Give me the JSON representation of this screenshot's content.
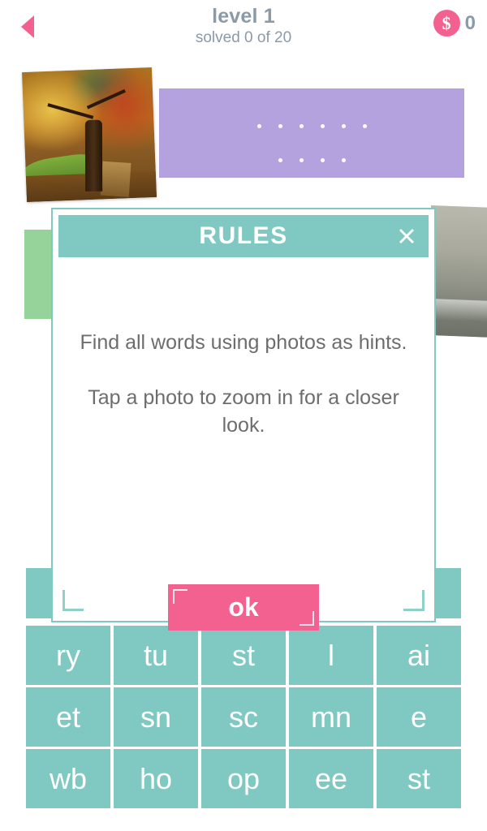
{
  "header": {
    "back_icon": "back-triangle-icon",
    "level_title": "level 1",
    "solved_text": "solved 0 of 20",
    "coin_icon": "dollar-coin-icon",
    "coin_symbol": "$",
    "coin_count": "0",
    "title_color": "#8a9aa8",
    "accent_pink": "#f2618f"
  },
  "puzzle": {
    "photo_1_alt": "autumn-tree-photo",
    "photo_2_alt": "seascape-photo",
    "word_slot_panel_color": "#b3a2dd",
    "slot_row_1_dots": 6,
    "slot_row_2_dots": 4,
    "green_panel_color": "#96d39b"
  },
  "answer_bar": {
    "current_text": "",
    "color": "#7fc9c2"
  },
  "tiles": {
    "color": "#7fc9c2",
    "rows": [
      [
        "ry",
        "tu",
        "st",
        "l",
        "ai"
      ],
      [
        "et",
        "sn",
        "sc",
        "mn",
        "e"
      ],
      [
        "wb",
        "ho",
        "op",
        "ee",
        "st"
      ]
    ]
  },
  "dialog": {
    "title": "RULES",
    "close_icon": "close-x-icon",
    "header_color": "#7fc9c2",
    "paragraph_1": "Find all words using photos as hints.",
    "paragraph_2": "Tap a photo to zoom in for a closer look.",
    "ok_label": "ok",
    "ok_color": "#f2618f",
    "text_color": "#6d6d6d"
  }
}
